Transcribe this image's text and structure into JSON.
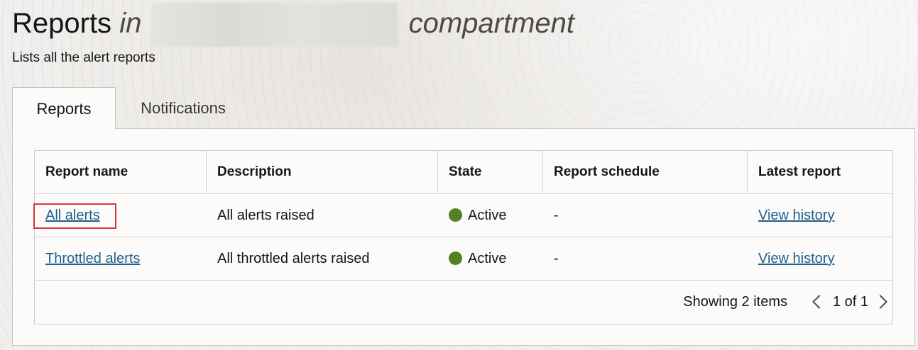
{
  "header": {
    "title_main": "Reports",
    "title_in": "in",
    "title_suffix": "compartment",
    "subtitle": "Lists all the alert reports"
  },
  "tabs": [
    {
      "label": "Reports",
      "active": true
    },
    {
      "label": "Notifications",
      "active": false
    }
  ],
  "table": {
    "columns": [
      "Report name",
      "Description",
      "State",
      "Report schedule",
      "Latest report"
    ],
    "rows": [
      {
        "name": "All alerts",
        "description": "All alerts raised",
        "state": "Active",
        "schedule": "-",
        "latest": "View history"
      },
      {
        "name": "Throttled alerts",
        "description": "All throttled alerts raised",
        "state": "Active",
        "schedule": "-",
        "latest": "View history"
      }
    ]
  },
  "footer": {
    "showing": "Showing 2 items",
    "page": "1 of 1"
  },
  "colors": {
    "link": "#1d5f8a",
    "active_status": "#508223",
    "highlight": "#d9373a"
  },
  "icons": [
    "status-dot-icon",
    "chevron-left-icon",
    "chevron-right-icon"
  ]
}
